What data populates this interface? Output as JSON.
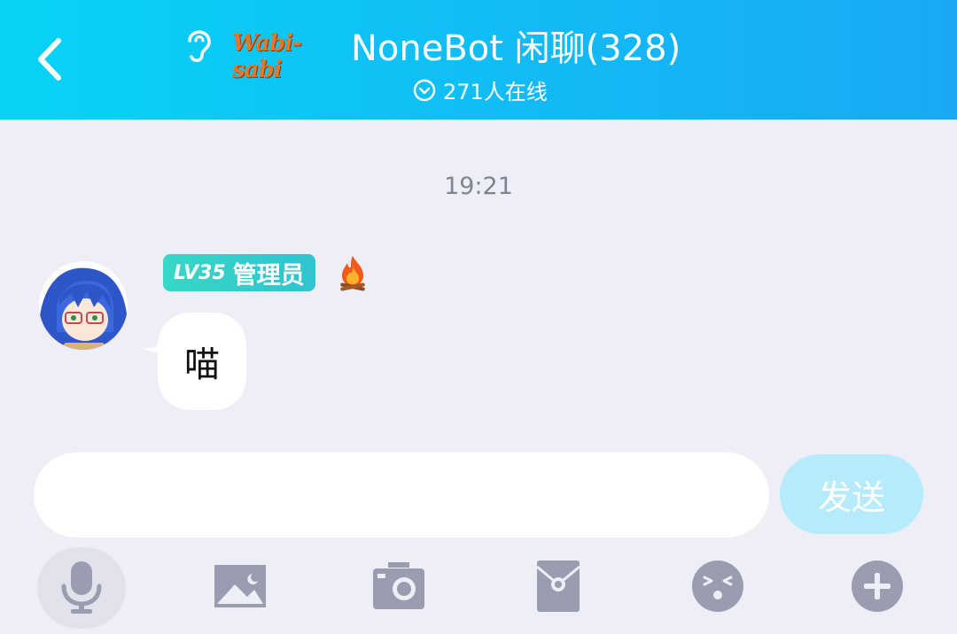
{
  "header": {
    "logo_text": "Wabi-sabi",
    "title": "NoneBot 闲聊(328)",
    "online": "271人在线"
  },
  "chat": {
    "time": "19:21",
    "message": {
      "level": "LV35",
      "role": "管理员",
      "text": "喵"
    }
  },
  "input": {
    "placeholder": "",
    "send_label": "发送"
  },
  "toolbar": [
    "mic-icon",
    "image-icon",
    "camera-icon",
    "red-packet-icon",
    "emoji-icon",
    "plus-icon"
  ],
  "colors": {
    "header_start": "#07d3f6",
    "header_end": "#1aa8f4",
    "badge": "#38d7c6",
    "send_disabled": "#b6ebfb",
    "icon_gray": "#9a9cb0"
  }
}
